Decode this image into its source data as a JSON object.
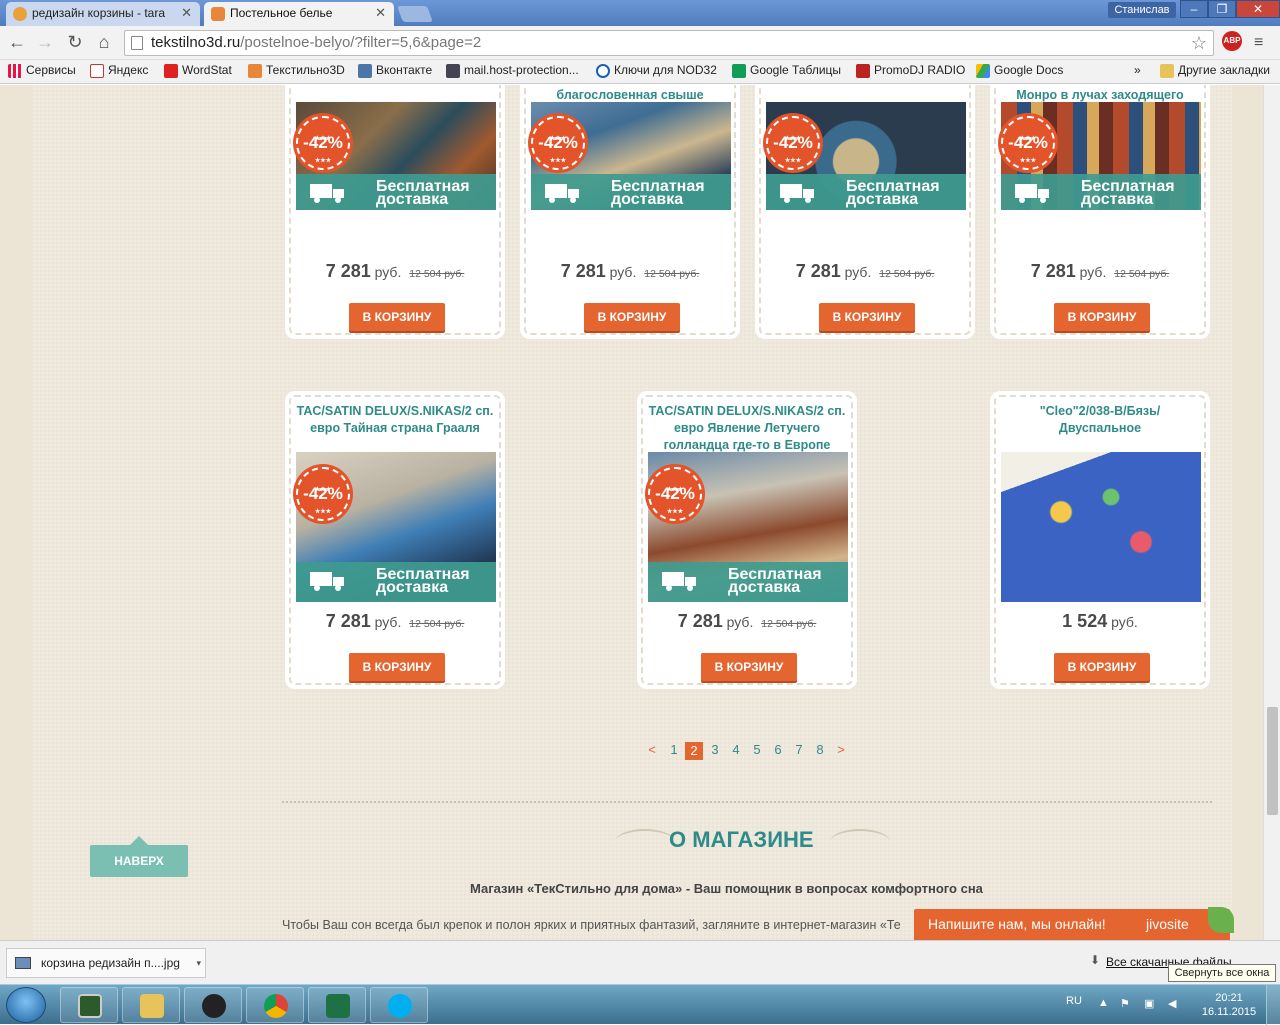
{
  "browser": {
    "tabs": [
      {
        "title": "редизайн корзины - tara"
      },
      {
        "title": "Постельное белье"
      }
    ],
    "user": "Станислав",
    "url_host": "tekstilno3d.ru",
    "url_path": "/postelnoe-belyo/?filter=5,6&page=2",
    "abp_label": "ABP",
    "bookmarks": [
      "Сервисы",
      "Яндекс",
      "WordStat",
      "Текстильно3D",
      "Вконтакте",
      "mail.host-protection...",
      "Ключи для NOD32",
      "Google Таблицы",
      "PromoDJ RADIO",
      "Google Docs"
    ],
    "bookmarks_more": "»",
    "other_bookmarks": "Другие закладки"
  },
  "products_row1": [
    {
      "title": "",
      "discount": "-42%",
      "shipping_line1": "Бесплатная",
      "shipping_line2": "доставка",
      "price": "7 281",
      "currency": "руб.",
      "old_price": "12 504 руб.",
      "button": "В КОРЗИНУ"
    },
    {
      "title": "благословенная свыше",
      "discount": "-42%",
      "shipping_line1": "Бесплатная",
      "shipping_line2": "доставка",
      "price": "7 281",
      "currency": "руб.",
      "old_price": "12 504 руб.",
      "button": "В КОРЗИНУ"
    },
    {
      "title": "",
      "discount": "-42%",
      "shipping_line1": "Бесплатная",
      "shipping_line2": "доставка",
      "price": "7 281",
      "currency": "руб.",
      "old_price": "12 504 руб.",
      "button": "В КОРЗИНУ"
    },
    {
      "title": "Монро в лучах заходящего",
      "discount": "-42%",
      "shipping_line1": "Бесплатная",
      "shipping_line2": "доставка",
      "price": "7 281",
      "currency": "руб.",
      "old_price": "12 504 руб.",
      "button": "В КОРЗИНУ"
    }
  ],
  "products_row2": [
    {
      "title_line1": "TAC/SATIN DELUX/S.NIKAS/2 сп.",
      "title_line2": "евро Тайная страна Грааля",
      "title_line3": "",
      "discount": "-42%",
      "shipping_line1": "Бесплатная",
      "shipping_line2": "доставка",
      "price": "7 281",
      "currency": "руб.",
      "old_price": "12 504 руб.",
      "button": "В КОРЗИНУ"
    },
    {
      "title_line1": "TAC/SATIN DELUX/S.NIKAS/2 сп.",
      "title_line2": "евро Явление Летучего",
      "title_line3": "голландца где-то в Европе",
      "discount": "-42%",
      "shipping_line1": "Бесплатная",
      "shipping_line2": "доставка",
      "price": "7 281",
      "currency": "руб.",
      "old_price": "12 504 руб.",
      "button": "В КОРЗИНУ"
    },
    {
      "title_line1": "\"Cleo\"2/038-B/Бязь/",
      "title_line2": "Двуспальное",
      "title_line3": "",
      "price": "1 524",
      "currency": "руб.",
      "button": "В КОРЗИНУ"
    }
  ],
  "pagination": {
    "prev": "<",
    "pages": [
      "1",
      "2",
      "3",
      "4",
      "5",
      "6",
      "7",
      "8"
    ],
    "current": "2",
    "next": ">"
  },
  "about": {
    "title": "О МАГАЗИНЕ",
    "subtitle": "Магазин «ТекСтильно для дома» - Ваш помощник в вопросах комфортного сна",
    "text": "Чтобы Ваш сон всегда был крепок и полон ярких и приятных фантазий, загляните в интернет-магазин «Те"
  },
  "back_to_top": "НАВЕРХ",
  "chat": {
    "label": "Напишите нам, мы онлайн!",
    "brand": "jivosite"
  },
  "downloads": {
    "file": "корзина редизайн п....jpg",
    "show_all": "Все скачанные файлы"
  },
  "tooltip": "Свернуть все окна",
  "taskbar": {
    "lang": "RU",
    "time": "20:21",
    "date": "16.11.2015"
  },
  "colors": {
    "accent_teal": "#2f8b89",
    "button_orange": "#e4652f",
    "discount_red": "#e4542b",
    "shipping_teal": "#3e9b8f"
  }
}
